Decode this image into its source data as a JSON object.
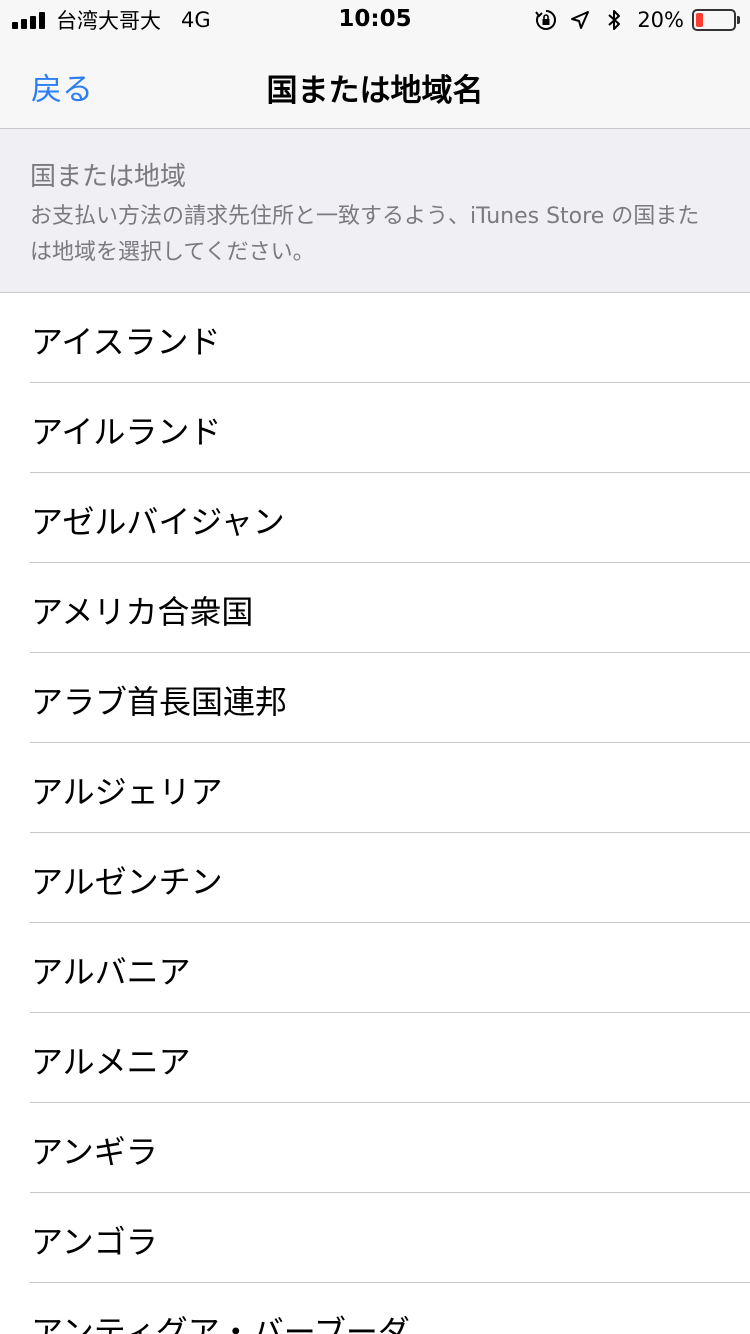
{
  "status_bar": {
    "carrier": "台湾大哥大",
    "network": "4G",
    "time": "10:05",
    "battery_percent": "20%",
    "battery_level": 0.2,
    "battery_color": "#ff3b30"
  },
  "nav": {
    "back_label": "戻る",
    "title": "国または地域名",
    "accent_color": "#2b7ef6"
  },
  "section": {
    "title": "国または地域",
    "description": "お支払い方法の請求先住所と一致するよう、iTunes Store の国または地域を選択してください。"
  },
  "countries": [
    "アイスランド",
    "アイルランド",
    "アゼルバイジャン",
    "アメリカ合衆国",
    "アラブ首長国連邦",
    "アルジェリア",
    "アルゼンチン",
    "アルバニア",
    "アルメニア",
    "アンギラ",
    "アンゴラ",
    "アンティグア・バーブーダ"
  ]
}
